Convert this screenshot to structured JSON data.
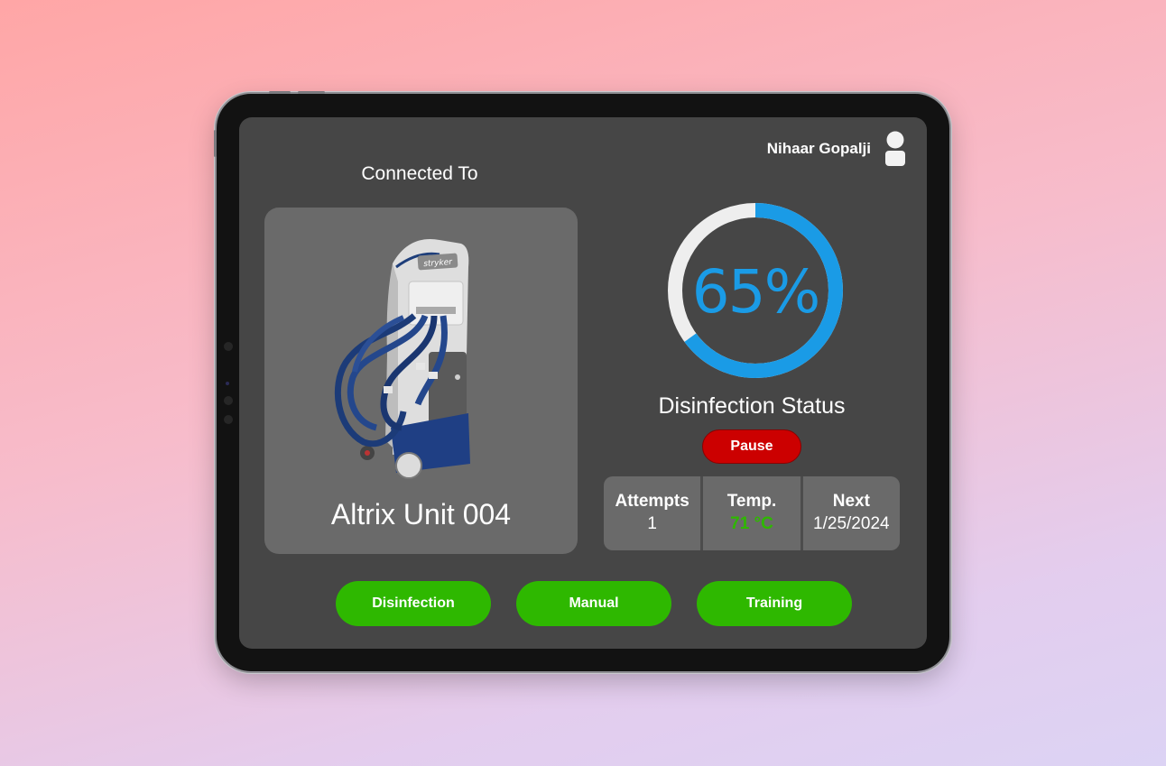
{
  "user": {
    "name": "Nihaar Gopalji",
    "icon": "user-avatar-icon"
  },
  "device": {
    "connected_label": "Connected To",
    "name": "Altrix Unit 004",
    "image_brand": "stryker"
  },
  "status": {
    "progress_percent": 65,
    "progress_text": "65%",
    "label": "Disinfection Status",
    "pause_label": "Pause"
  },
  "stats": [
    {
      "label": "Attempts",
      "value": "1"
    },
    {
      "label": "Temp.",
      "value": "71 °C"
    },
    {
      "label": "Next",
      "value": "1/25/2024"
    }
  ],
  "nav": {
    "disinfection": "Disinfection",
    "manual": "Manual",
    "training": "Training"
  },
  "colors": {
    "progress": "#1a9be6",
    "track": "#eeeeee",
    "pause": "#cc0000",
    "nav_green": "#2eb800",
    "temp_value": "#2eb800"
  }
}
